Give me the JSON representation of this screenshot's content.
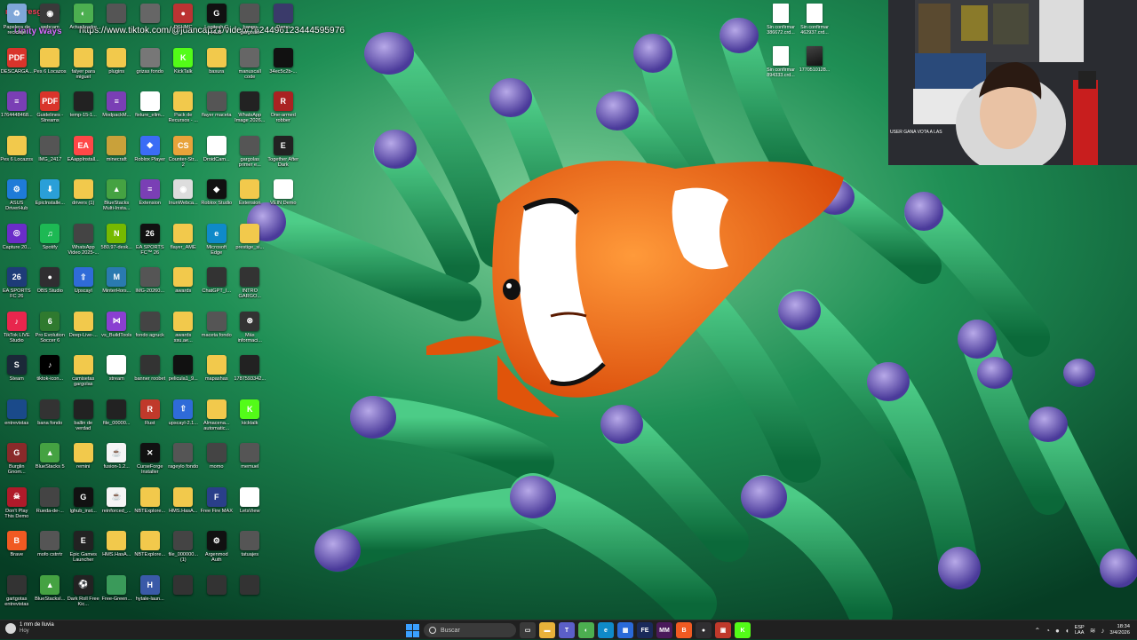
{
  "overlay": {
    "brand": "motoresgroup",
    "sub": "Unity Ways",
    "url": "https://www.tiktok.com/@juancap21/video/7624496123444595976"
  },
  "desktop_icons": [
    {
      "label": "Papelera de reciclaje",
      "icon": "recycle-bin-icon",
      "color": "#7fa7d8",
      "glyph": "♻"
    },
    {
      "label": "DESCARGA...",
      "icon": "pdf-icon",
      "color": "#d9342b",
      "glyph": "PDF"
    },
    {
      "label": "1764448468...",
      "icon": "winrar-icon",
      "color": "#7a3fb5",
      "glyph": "≡"
    },
    {
      "label": "Pes 6 Locazos",
      "icon": "folder-icon",
      "color": "#f2c94c",
      "glyph": ""
    },
    {
      "label": "ASUS DriverHub",
      "icon": "asus-icon",
      "color": "#1e7bd8",
      "glyph": "⚙"
    },
    {
      "label": "Capture 20...",
      "icon": "capture-icon",
      "color": "#6a2dc8",
      "glyph": "◎"
    },
    {
      "label": "EA SPORTS FC 26",
      "icon": "ea-fc-icon",
      "color": "#1e3c78",
      "glyph": "26"
    },
    {
      "label": "TikTok LIVE Studio",
      "icon": "tiktok-live-icon",
      "color": "#e8264d",
      "glyph": "♪"
    },
    {
      "label": "Steam",
      "icon": "steam-icon",
      "color": "#1b2838",
      "glyph": "S"
    },
    {
      "label": "entrevistas",
      "icon": "video-file-icon",
      "color": "#1a4a8a",
      "glyph": ""
    },
    {
      "label": "Burglin Gnom...",
      "icon": "game-icon",
      "color": "#8a2a2a",
      "glyph": "G"
    },
    {
      "label": "Don't Play This Demo",
      "icon": "game-icon",
      "color": "#b01a2a",
      "glyph": "☠"
    },
    {
      "label": "Brave",
      "icon": "brave-icon",
      "color": "#f05a22",
      "glyph": "B"
    },
    {
      "label": "gartgotas entrevistas",
      "icon": "video-file-icon",
      "color": "#333",
      "glyph": ""
    },
    {
      "label": "webcam",
      "icon": "webcam-icon",
      "color": "#3a3a3a",
      "glyph": "◉"
    },
    {
      "label": "Pes 6 Locazos",
      "icon": "folder-icon",
      "color": "#f2c94c",
      "glyph": ""
    },
    {
      "label": "Guidelines - Streams",
      "icon": "pdf-icon",
      "color": "#d9342b",
      "glyph": "PDF"
    },
    {
      "label": "IMG_2417",
      "icon": "image-icon",
      "color": "#555",
      "glyph": ""
    },
    {
      "label": "EpicInstalle...",
      "icon": "installer-icon",
      "color": "#2a9fd8",
      "glyph": "⬇"
    },
    {
      "label": "Spotify",
      "icon": "spotify-icon",
      "color": "#1db954",
      "glyph": "♫"
    },
    {
      "label": "OBS Studio",
      "icon": "obs-icon",
      "color": "#302e31",
      "glyph": "●"
    },
    {
      "label": "Pro Evolution Soccer 6",
      "icon": "pes-icon",
      "color": "#2f7a2f",
      "glyph": "6"
    },
    {
      "label": "tiktok-icon...",
      "icon": "tiktok-icon",
      "color": "#000",
      "glyph": "♪"
    },
    {
      "label": "bana fondo",
      "icon": "image-icon",
      "color": "#333",
      "glyph": ""
    },
    {
      "label": "BlueStacks 5",
      "icon": "bluestacks-icon",
      "color": "#45a242",
      "glyph": "▲"
    },
    {
      "label": "Rueda-de-...",
      "icon": "image-icon",
      "color": "#444",
      "glyph": ""
    },
    {
      "label": "mofo cstrrtr",
      "icon": "image-icon",
      "color": "#555",
      "glyph": ""
    },
    {
      "label": "BlueStacksI...",
      "icon": "bluestacks-icon",
      "color": "#45a242",
      "glyph": "▲"
    },
    {
      "label": "Actualizador",
      "icon": "chrome-icon",
      "color": "#4caf50",
      "glyph": "◐"
    },
    {
      "label": "falyer para miguel",
      "icon": "folder-icon",
      "color": "#f2c94c",
      "glyph": ""
    },
    {
      "label": "temp-15-1...",
      "icon": "file-icon",
      "color": "#222",
      "glyph": ""
    },
    {
      "label": "EAappInstall...",
      "icon": "ea-icon",
      "color": "#ff4747",
      "glyph": "EA"
    },
    {
      "label": "drivers (1)",
      "icon": "folder-icon",
      "color": "#f2c94c",
      "glyph": ""
    },
    {
      "label": "WhatsApp Video 2025-...",
      "icon": "video-file-icon",
      "color": "#444",
      "glyph": ""
    },
    {
      "label": "Upscayl",
      "icon": "upscayl-icon",
      "color": "#2f6bd8",
      "glyph": "⇧"
    },
    {
      "label": "Deep-Live-...",
      "icon": "folder-icon",
      "color": "#f2c94c",
      "glyph": ""
    },
    {
      "label": "camisetas gargolas",
      "icon": "folder-icon",
      "color": "#f2c94c",
      "glyph": ""
    },
    {
      "label": "ballin de verdad",
      "icon": "video-file-icon",
      "color": "#222",
      "glyph": ""
    },
    {
      "label": "remini",
      "icon": "folder-icon",
      "color": "#f2c94c",
      "glyph": ""
    },
    {
      "label": "lghub_inst...",
      "icon": "logitech-icon",
      "color": "#111",
      "glyph": "G"
    },
    {
      "label": "Epic Games Launcher",
      "icon": "epic-icon",
      "color": "#222",
      "glyph": "E"
    },
    {
      "label": "Dark Roll Free Kic...",
      "icon": "game-icon",
      "color": "#222",
      "glyph": "⚽"
    },
    {
      "label": "",
      "icon": "image-icon",
      "color": "#555",
      "glyph": ""
    },
    {
      "label": "plugins",
      "icon": "folder-icon",
      "color": "#f2c94c",
      "glyph": ""
    },
    {
      "label": "ModpackM...",
      "icon": "winrar-icon",
      "color": "#7a3fb5",
      "glyph": "≡"
    },
    {
      "label": "minecraft",
      "icon": "folder-icon",
      "color": "#c9a13a",
      "glyph": ""
    },
    {
      "label": "BlueStacks Multi-Insta...",
      "icon": "bluestacks-icon",
      "color": "#45a242",
      "glyph": "▲"
    },
    {
      "label": "580.97-desk...",
      "icon": "nvidia-icon",
      "color": "#76b900",
      "glyph": "N"
    },
    {
      "label": "MinterHors...",
      "icon": "app-icon",
      "color": "#2a7ab0",
      "glyph": "M"
    },
    {
      "label": "vs_BuildTools",
      "icon": "vs-icon",
      "color": "#8a3fd1",
      "glyph": "⋈"
    },
    {
      "label": "stream",
      "icon": "file-icon",
      "color": "#fff",
      "glyph": ""
    },
    {
      "label": "file_00000...",
      "icon": "image-icon",
      "color": "#222",
      "glyph": ""
    },
    {
      "label": "fusion-1.2...",
      "icon": "java-icon",
      "color": "#f5f5f5",
      "glyph": "☕"
    },
    {
      "label": "reinforced_...",
      "icon": "java-icon",
      "color": "#f5f5f5",
      "glyph": "☕"
    },
    {
      "label": "HMS.HasA...",
      "icon": "folder-icon",
      "color": "#f2c94c",
      "glyph": ""
    },
    {
      "label": "Free-Green...",
      "icon": "image-icon",
      "color": "#3a9a5a",
      "glyph": ""
    },
    {
      "label": "",
      "icon": "image-icon",
      "color": "#666",
      "glyph": ""
    },
    {
      "label": "grizas fondo",
      "icon": "image-icon",
      "color": "#777",
      "glyph": ""
    },
    {
      "label": "fixture_elim...",
      "icon": "file-icon",
      "color": "#fff",
      "glyph": ""
    },
    {
      "label": "Roblox Player",
      "icon": "roblox-icon",
      "color": "#3b6cf6",
      "glyph": "◆"
    },
    {
      "label": "Extension",
      "icon": "winrar-icon",
      "color": "#7a3fb5",
      "glyph": "≡"
    },
    {
      "label": "EA SPORTS FC™ 26",
      "icon": "ea-fc-icon",
      "color": "#111",
      "glyph": "26"
    },
    {
      "label": "IMG-20260...",
      "icon": "image-icon",
      "color": "#555",
      "glyph": ""
    },
    {
      "label": "fondo agruck",
      "icon": "image-icon",
      "color": "#444",
      "glyph": ""
    },
    {
      "label": "banner roobet",
      "icon": "image-icon",
      "color": "#333",
      "glyph": ""
    },
    {
      "label": "Rust",
      "icon": "rust-icon",
      "color": "#c0392b",
      "glyph": "R"
    },
    {
      "label": "CurseForge Installer",
      "icon": "curseforge-icon",
      "color": "#111",
      "glyph": "✕"
    },
    {
      "label": "NBTExplore...",
      "icon": "folder-icon",
      "color": "#f2c94c",
      "glyph": ""
    },
    {
      "label": "NBTExplore...",
      "icon": "folder-icon",
      "color": "#f2c94c",
      "glyph": ""
    },
    {
      "label": "hytale-laun...",
      "icon": "hytale-icon",
      "color": "#3a5aa8",
      "glyph": "H"
    },
    {
      "label": "DSHMC",
      "icon": "app-icon",
      "color": "#b33",
      "glyph": "●"
    },
    {
      "label": "KickTalk",
      "icon": "kick-icon",
      "color": "#53fc18",
      "glyph": "K"
    },
    {
      "label": "Pack de Recursos - ...",
      "icon": "folder-icon",
      "color": "#f2c94c",
      "glyph": ""
    },
    {
      "label": "Counter-Str... 2",
      "icon": "cs2-icon",
      "color": "#e8a33a",
      "glyph": "CS"
    },
    {
      "label": "InunWebca...",
      "icon": "app-icon",
      "color": "#ddd",
      "glyph": "◉"
    },
    {
      "label": "flayer_AME",
      "icon": "folder-icon",
      "color": "#f2c94c",
      "glyph": ""
    },
    {
      "label": "awards",
      "icon": "folder-icon",
      "color": "#f2c94c",
      "glyph": ""
    },
    {
      "label": "awards ssu.ae...",
      "icon": "folder-icon",
      "color": "#f2c94c",
      "glyph": ""
    },
    {
      "label": "pelicula1_9...",
      "icon": "video-file-icon",
      "color": "#111",
      "glyph": ""
    },
    {
      "label": "upscayl-2.1...",
      "icon": "app-icon",
      "color": "#2f6bd8",
      "glyph": "⇧"
    },
    {
      "label": "rageylo fondo",
      "icon": "image-icon",
      "color": "#555",
      "glyph": ""
    },
    {
      "label": "HMS.HasA...",
      "icon": "folder-icon",
      "color": "#f2c94c",
      "glyph": ""
    },
    {
      "label": "file_000000... (1)",
      "icon": "image-icon",
      "color": "#444",
      "glyph": ""
    },
    {
      "label": "",
      "icon": "image-icon",
      "color": "#333",
      "glyph": ""
    },
    {
      "label": "Logitech G HUB",
      "icon": "logitech-icon",
      "color": "#111",
      "glyph": "G"
    },
    {
      "label": "basura",
      "icon": "folder-icon",
      "color": "#f2c94c",
      "glyph": ""
    },
    {
      "label": "flayer maceta",
      "icon": "image-icon",
      "color": "#555",
      "glyph": ""
    },
    {
      "label": "DroidCam...",
      "icon": "droidcam-icon",
      "color": "#fff",
      "glyph": "◎"
    },
    {
      "label": "Roblox Studio",
      "icon": "roblox-icon",
      "color": "#111",
      "glyph": "◆"
    },
    {
      "label": "Microsoft Edge",
      "icon": "edge-icon",
      "color": "#0f8ac9",
      "glyph": "e"
    },
    {
      "label": "ChatGPT_I...",
      "icon": "image-icon",
      "color": "#333",
      "glyph": ""
    },
    {
      "label": "maceta fondo",
      "icon": "image-icon",
      "color": "#555",
      "glyph": ""
    },
    {
      "label": "mapashas",
      "icon": "folder-icon",
      "color": "#f2c94c",
      "glyph": ""
    },
    {
      "label": "Almacena... automatic...",
      "icon": "folder-icon",
      "color": "#f2c94c",
      "glyph": ""
    },
    {
      "label": "momo",
      "icon": "image-icon",
      "color": "#444",
      "glyph": ""
    },
    {
      "label": "Free Fire MAX",
      "icon": "freefire-icon",
      "color": "#2a3f8a",
      "glyph": "F"
    },
    {
      "label": "Argenmod Auth",
      "icon": "app-icon",
      "color": "#111",
      "glyph": "⚙"
    },
    {
      "label": "",
      "icon": "image-icon",
      "color": "#333",
      "glyph": ""
    },
    {
      "label": "bango gargoals",
      "icon": "image-icon",
      "color": "#555",
      "glyph": ""
    },
    {
      "label": "manuscall code",
      "icon": "image-icon",
      "color": "#666",
      "glyph": ""
    },
    {
      "label": "WhatsApp Image 2026...",
      "icon": "image-icon",
      "color": "#222",
      "glyph": ""
    },
    {
      "label": "gargolas primer e...",
      "icon": "image-icon",
      "color": "#555",
      "glyph": ""
    },
    {
      "label": "Extension",
      "icon": "folder-icon",
      "color": "#f2c94c",
      "glyph": ""
    },
    {
      "label": "prestige_si...",
      "icon": "folder-icon",
      "color": "#f2c94c",
      "glyph": ""
    },
    {
      "label": "INTRO GARGO...",
      "icon": "video-file-icon",
      "color": "#333",
      "glyph": ""
    },
    {
      "label": "Más informaci...",
      "icon": "info-icon",
      "color": "#333",
      "glyph": "⊗"
    },
    {
      "label": "1787593342...",
      "icon": "image-icon",
      "color": "#222",
      "glyph": ""
    },
    {
      "label": "kicktalk",
      "icon": "kick-icon",
      "color": "#53fc18",
      "glyph": "K"
    },
    {
      "label": "memuel",
      "icon": "image-icon",
      "color": "#555",
      "glyph": ""
    },
    {
      "label": "LetsView",
      "icon": "letsview-icon",
      "color": "#fff",
      "glyph": "◈"
    },
    {
      "label": "tatuajes",
      "icon": "image-icon",
      "color": "#555",
      "glyph": ""
    },
    {
      "label": "",
      "icon": "image-icon",
      "color": "#333",
      "glyph": ""
    },
    {
      "label": "Demo",
      "icon": "image-icon",
      "color": "#3a3a6a",
      "glyph": ""
    },
    {
      "label": "34ec5c2b-...",
      "icon": "file-icon",
      "color": "#111",
      "glyph": ""
    },
    {
      "label": "One-armed robber",
      "icon": "game-icon",
      "color": "#a22",
      "glyph": "R"
    },
    {
      "label": "Together After Dark",
      "icon": "epic-icon",
      "color": "#222",
      "glyph": "E"
    },
    {
      "label": "VEIN Demo",
      "icon": "file-icon",
      "color": "#fff",
      "glyph": ""
    }
  ],
  "right_icons": [
    {
      "label": "Sin confirmar 386672.crd...",
      "icon": "file-icon",
      "img": false
    },
    {
      "label": "Sin confirmar 462937.crd...",
      "icon": "file-icon",
      "img": false
    },
    {
      "label": "Sin confirmar 894333.crd...",
      "icon": "file-icon",
      "img": false
    },
    {
      "label": "1770510128...",
      "icon": "image-icon",
      "img": true
    }
  ],
  "webcam": {
    "label": "USER GANA VOTA A LAS"
  },
  "taskbar": {
    "weather_temp": "1 mm de lluvia",
    "weather_sub": "Hoy",
    "search_placeholder": "Buscar",
    "apps": [
      {
        "name": "task-view",
        "color": "#3a3a3a",
        "glyph": "▭"
      },
      {
        "name": "file-explorer",
        "color": "#e8b23a",
        "glyph": "▬"
      },
      {
        "name": "teams",
        "color": "#5b5fc7",
        "glyph": "T"
      },
      {
        "name": "chrome",
        "color": "#4caf50",
        "glyph": "◐"
      },
      {
        "name": "edge",
        "color": "#0f8ac9",
        "glyph": "e"
      },
      {
        "name": "calculator",
        "color": "#2a6ad8",
        "glyph": "▦"
      },
      {
        "name": "fe-app",
        "color": "#1a2a5a",
        "glyph": "FE"
      },
      {
        "name": "mm-app",
        "color": "#4a1a5a",
        "glyph": "MM"
      },
      {
        "name": "brave",
        "color": "#f05a22",
        "glyph": "B"
      },
      {
        "name": "obs",
        "color": "#302e31",
        "glyph": "●"
      },
      {
        "name": "recorder",
        "color": "#c0392b",
        "glyph": "▣"
      },
      {
        "name": "kick",
        "color": "#53fc18",
        "glyph": "K"
      }
    ],
    "lang_line1": "ESP",
    "lang_line2": "LAA",
    "time": "18:34",
    "date": "3/4/2026"
  }
}
